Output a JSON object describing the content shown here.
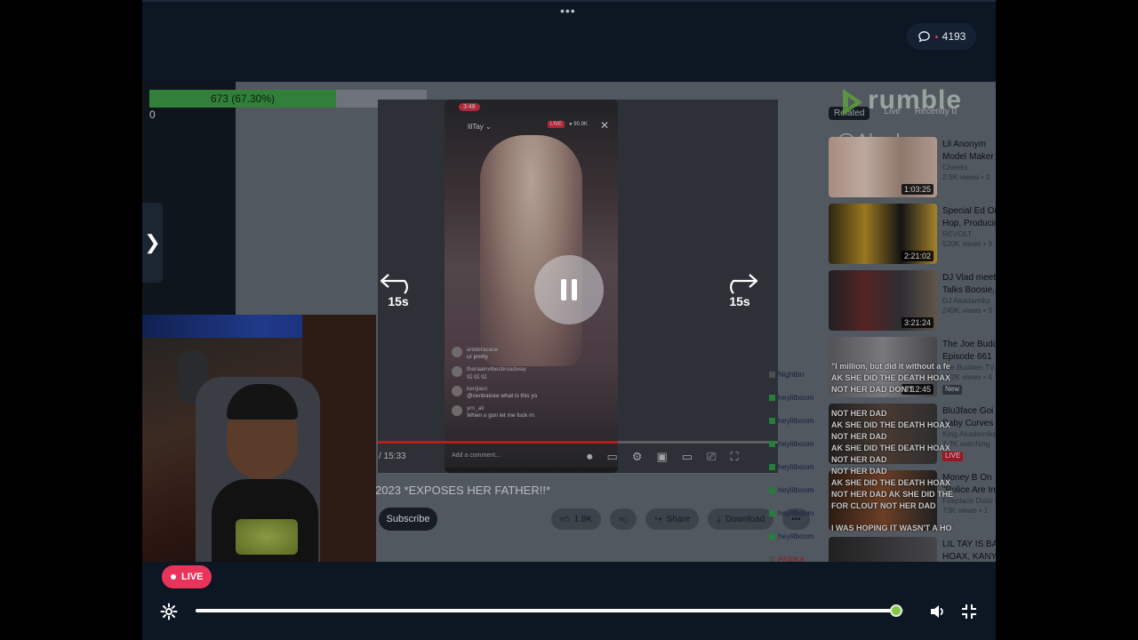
{
  "player": {
    "menu_dots": "•••",
    "chat_count": "4193",
    "skip_back_label": "15s",
    "skip_forward_label": "15s",
    "live_label": "LIVE",
    "progress_fraction": 0.99
  },
  "capture": {
    "goal_bar": {
      "text": "673 (67.30%)",
      "fraction": 0.673,
      "zero_label": "0"
    },
    "phone": {
      "time": "3:48",
      "user": "lilTay ⌄",
      "live": "LIVE",
      "viewers": "● 90.9K",
      "comments": [
        {
          "user": "anldefacase",
          "text": "ur pretty"
        },
        {
          "user": "theraainvibesbroadway",
          "text": "ꞔꞔ ꞔꞔ ꞔꞔ"
        },
        {
          "user": "kenjiacc",
          "text": "@centraicee what is this yo"
        },
        {
          "user": "yrn_all",
          "text": "When u gon let me fuck rn"
        }
      ],
      "add_comment": "Add a comment..."
    },
    "video_time": "/ 15:33",
    "video_title": "2023 *EXPOSES HER FATHER!!*",
    "subscribe": "Subscribe",
    "likes": "1.8K",
    "share": "Share",
    "download": "Download",
    "more": "•••",
    "watermark_brand": "rumble",
    "watermark_handle": "@Akadem",
    "tabs": [
      "Related",
      "Live",
      "Recently u"
    ],
    "related": [
      {
        "title": "Lil Anonym",
        "title2": "Model Maker",
        "channel": "Cheeks",
        "meta": "2.5K views • 2",
        "duration": "1:03:25"
      },
      {
        "title": "Special Ed On",
        "title2": "Hop, Producin",
        "channel": "REVOLT",
        "meta": "520K views • 3",
        "duration": "2:21:02"
      },
      {
        "title": "DJ Vlad meet",
        "title2": "Talks Boosie,",
        "channel": "DJ Akadamiks",
        "meta": "249K views • 3",
        "duration": "3:21:24"
      },
      {
        "title": "The Joe Budd",
        "title2": "Episode 661",
        "channel": "Joe Budden TV",
        "meta": "272K views • 4",
        "duration": "3:12:45",
        "badge": "New"
      },
      {
        "title": "Blu3face Goi",
        "title2": "Baby Curves",
        "channel": "King Akademiks",
        "meta": "7.2K watching",
        "duration": "",
        "badge": "LIVE"
      },
      {
        "title": "Money B On",
        "title2": "\"Police Are In",
        "channel": "Fireplace Dialo",
        "meta": "73K views • 1",
        "duration": ""
      },
      {
        "title": "LIL TAY IS BA",
        "title2": "HOAX, KANY",
        "channel": "",
        "meta": "",
        "duration": ""
      }
    ],
    "chat_lines": [
      "Nightbo",
      "heylilboom",
      "heylilboom",
      "heylilboom",
      "heylilboom",
      "heylilboom",
      "heylilboom",
      "heylilboom",
      "heylilboom",
      "PASIKA"
    ],
    "overlay_lines": [
      "\"I million, but did it without a fe",
      "AK SHE DID THE DEATH HOAX",
      "NOT HER DAD DON'T",
      "NOT HER DAD",
      "AK SHE DID THE DEATH HOAX",
      "NOT HER DAD",
      "AK SHE DID THE DEATH HOAX",
      "NOT HER DAD",
      "NOT HER DAD",
      "AK SHE DID THE DEATH HOAX",
      "NOT HER DAD AK SHE DID THE",
      "FOR CLOUT NOT HER DAD",
      "",
      "I WAS HOPING IT WASN'T A HO"
    ]
  },
  "colors": {
    "stage_bg": "#0d1724",
    "live_badge": "#e8335b",
    "scrub_knob": "#85c742",
    "goal_green": "#3fa34a"
  },
  "icons": {
    "chat": "speech-bubble-icon",
    "pause": "pause-icon",
    "skip_back": "rewind-15-icon",
    "skip_forward": "forward-15-icon",
    "settings": "gear-icon",
    "volume": "speaker-icon",
    "fullscreen_exit": "minimize-icon",
    "side": "chevron-right-icon"
  }
}
